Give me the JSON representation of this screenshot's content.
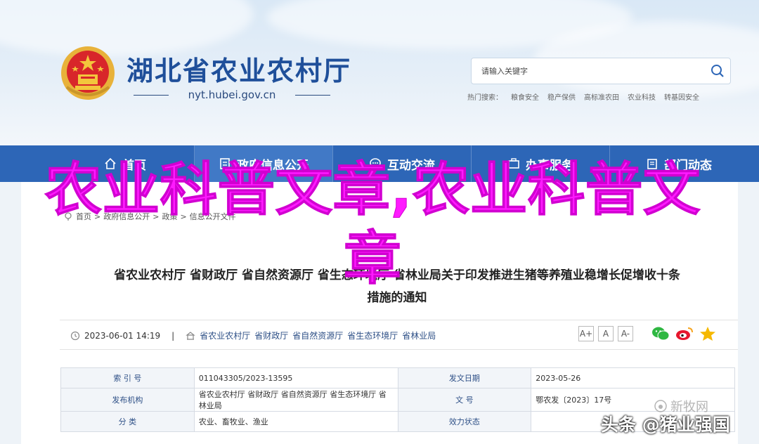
{
  "header": {
    "site_title": "湖北省农业农村厅",
    "domain": "nyt.hubei.gov.cn",
    "search_placeholder": "请输入关键字",
    "hot_label": "热门搜索：",
    "hot_words": [
      "粮食安全",
      "稳产保供",
      "高标准农田",
      "农业科技",
      "转基因安全"
    ]
  },
  "nav": {
    "items": [
      {
        "label": "首页",
        "icon": "home-icon"
      },
      {
        "label": "政府信息公开",
        "icon": "document-icon"
      },
      {
        "label": "互动交流",
        "icon": "chat-icon"
      },
      {
        "label": "办事服务",
        "icon": "briefcase-icon"
      },
      {
        "label": "部门动态",
        "icon": "building-icon"
      }
    ]
  },
  "breadcrumb": [
    "首页",
    "政府信息公开",
    "政策",
    "信息公开文件"
  ],
  "article": {
    "title_line1": "省农业农村厅 省财政厅 省自然资源厅 省生态环境厅 省林业局关于印发推进生猪等养殖业稳增长促增收十条",
    "title_line2": "措施的通知",
    "date": "2023-06-01 14:19",
    "sep": "|",
    "publishers": [
      "省农业农村厅",
      "省财政厅",
      "省自然资源厅",
      "省生态环境厅",
      "省林业局"
    ],
    "font_buttons": [
      "A+",
      "A",
      "A-"
    ]
  },
  "info_table": [
    {
      "k1": "索 引 号",
      "v1": "011043305/2023-13595",
      "k2": "发文日期",
      "v2": "2023-05-26"
    },
    {
      "k1": "发布机构",
      "v1": "省农业农村厅 省财政厅 省自然资源厅 省生态环境厅 省林业局",
      "k2": "文 号",
      "v2": "鄂农发〔2023〕17号"
    },
    {
      "k1": "分 类",
      "v1": "农业、畜牧业、渔业",
      "k2": "效力状态",
      "v2": ""
    }
  ],
  "overlay": {
    "title": "农业科普文章,农业科普文章"
  },
  "watermarks": {
    "gray": "新牧网",
    "main": "头条 @猪业强国"
  },
  "colors": {
    "brand_blue": "#2d66b7",
    "title_blue": "#1f4f9a",
    "overlay_magenta": "#ff1aff"
  }
}
